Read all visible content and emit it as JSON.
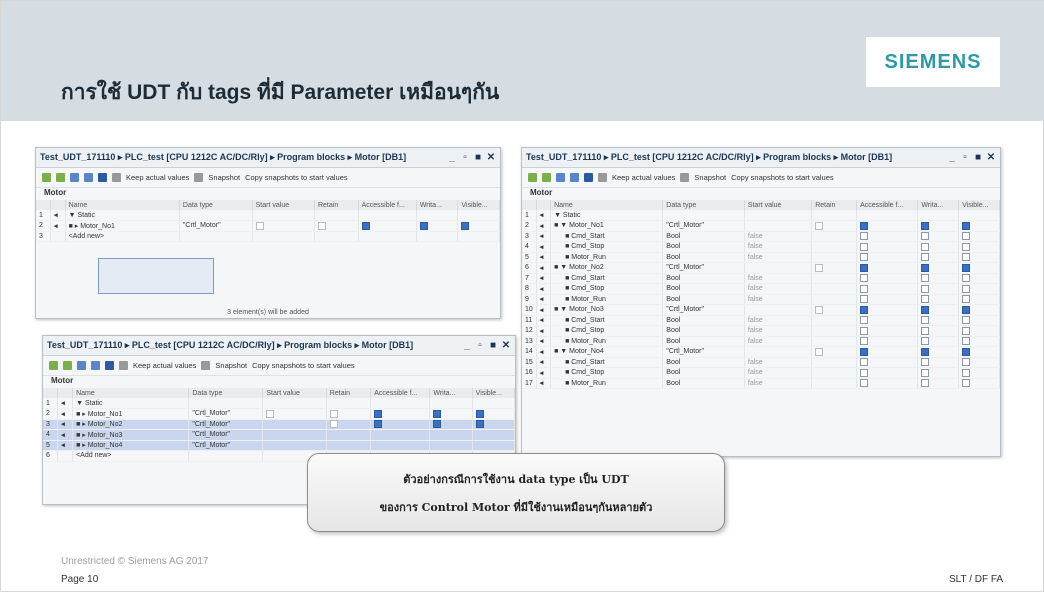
{
  "slide": {
    "title": "การใช้ UDT กับ tags ที่มี Parameter เหมือนๆกัน",
    "logo": "SIEMENS",
    "footer_copyright": "Unrestricted © Siemens AG 2017",
    "footer_page": "Page 10",
    "footer_right": "SLT / DF FA"
  },
  "colors": {
    "header_band": "#d5dde3",
    "logo": "#2e9aa6",
    "selection": "#c9d6ee"
  },
  "window_common": {
    "path": "Test_UDT_171110 ▸ PLC_test [CPU 1212C AC/DC/Rly] ▸ Program blocks ▸ Motor [DB1]",
    "controls": [
      "_",
      "▫",
      "■",
      "✕"
    ],
    "toolbar": {
      "keep": "Keep actual values",
      "snapshot": "Snapshot",
      "copy": "Copy snapshots to start values"
    },
    "block": "Motor",
    "headers": [
      "Name",
      "Data type",
      "Start value",
      "Retain",
      "Accessible f...",
      "Writa...",
      "Visible..."
    ]
  },
  "win1": {
    "rows": [
      {
        "n": "1",
        "name": "▼ Static",
        "type": "",
        "start": ""
      },
      {
        "n": "2",
        "name": "■ ▸ Motor_No1",
        "type": "\"Crtl_Motor\"",
        "start": ""
      },
      {
        "n": "3",
        "name": "<Add new>",
        "type": "",
        "start": ""
      }
    ],
    "note": "3 element(s) will be added"
  },
  "win2": {
    "rows": [
      {
        "n": "1",
        "name": "▼ Static",
        "type": ""
      },
      {
        "n": "2",
        "name": "■ ▸ Motor_No1",
        "type": "\"Crtl_Motor\""
      },
      {
        "n": "3",
        "name": "■ ▸ Motor_No2",
        "type": "\"Crtl_Motor\""
      },
      {
        "n": "4",
        "name": "■ ▸ Motor_No3",
        "type": "\"Crtl_Motor\""
      },
      {
        "n": "5",
        "name": "■ ▸ Motor_No4",
        "type": "\"Crtl_Motor\""
      },
      {
        "n": "6",
        "name": "<Add new>",
        "type": ""
      }
    ]
  },
  "win3": {
    "rows": [
      {
        "n": "1",
        "name": "▼ Static",
        "type": "",
        "start": ""
      },
      {
        "n": "2",
        "name": "■ ▼ Motor_No1",
        "type": "\"Crtl_Motor\"",
        "start": ""
      },
      {
        "n": "3",
        "name": "■ Cmd_Start",
        "type": "Bool",
        "start": "false"
      },
      {
        "n": "4",
        "name": "■ Cmd_Stop",
        "type": "Bool",
        "start": "false"
      },
      {
        "n": "5",
        "name": "■ Motor_Run",
        "type": "Bool",
        "start": "false"
      },
      {
        "n": "6",
        "name": "■ ▼ Motor_No2",
        "type": "\"Crtl_Motor\"",
        "start": ""
      },
      {
        "n": "7",
        "name": "■ Cmd_Start",
        "type": "Bool",
        "start": "false"
      },
      {
        "n": "8",
        "name": "■ Cmd_Stop",
        "type": "Bool",
        "start": "false"
      },
      {
        "n": "9",
        "name": "■ Motor_Run",
        "type": "Bool",
        "start": "false"
      },
      {
        "n": "10",
        "name": "■ ▼ Motor_No3",
        "type": "\"Crtl_Motor\"",
        "start": ""
      },
      {
        "n": "11",
        "name": "■ Cmd_Start",
        "type": "Bool",
        "start": "false"
      },
      {
        "n": "12",
        "name": "■ Cmd_Stop",
        "type": "Bool",
        "start": "false"
      },
      {
        "n": "13",
        "name": "■ Motor_Run",
        "type": "Bool",
        "start": "false"
      },
      {
        "n": "14",
        "name": "■ ▼ Motor_No4",
        "type": "\"Crtl_Motor\"",
        "start": ""
      },
      {
        "n": "15",
        "name": "■ Cmd_Start",
        "type": "Bool",
        "start": "false"
      },
      {
        "n": "16",
        "name": "■ Cmd_Stop",
        "type": "Bool",
        "start": "false"
      },
      {
        "n": "17",
        "name": "■ Motor_Run",
        "type": "Bool",
        "start": "false"
      }
    ]
  },
  "callout": {
    "line1": "ตัวอย่างกรณีการใช้งาน data type เป็น UDT",
    "line2": "ของการ Control Motor ที่มีใช้งานเหมือนๆกันหลายตัว"
  }
}
